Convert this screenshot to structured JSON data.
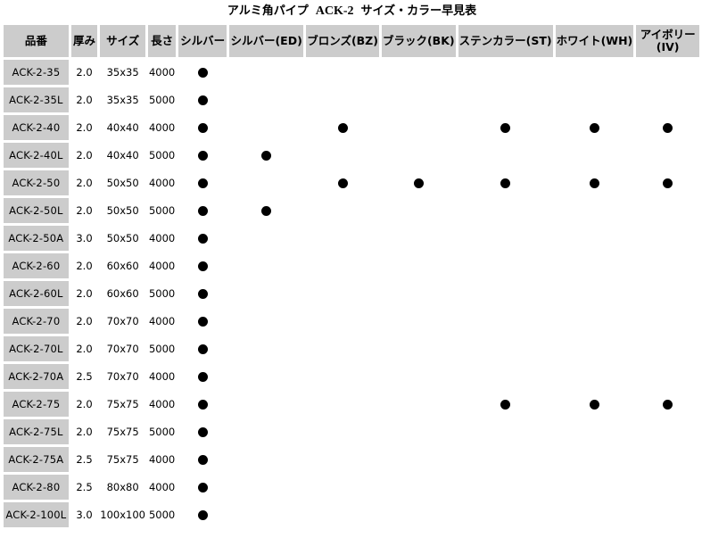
{
  "title": {
    "prefix": "アルミ角パイプ",
    "code": "ACK-2",
    "suffix": "サイズ・カラー早見表"
  },
  "table": {
    "headers": [
      "品番",
      "厚み",
      "サイズ",
      "長さ",
      "シルバー",
      "シルバー(ED)",
      "ブロンズ(BZ)",
      "ブラック(BK)",
      "ステンカラー(ST)",
      "ホワイト(WH)",
      "アイボリー\n(IV)"
    ],
    "header_lines": {
      "ivory_line1": "アイボリー",
      "ivory_line2": "(IV)"
    },
    "availability_marker": "●",
    "rows": [
      {
        "code": "ACK-2-35",
        "thickness": "2.0",
        "size": "35x35",
        "length": "4000",
        "colors": [
          true,
          false,
          false,
          false,
          false,
          false,
          false
        ]
      },
      {
        "code": "ACK-2-35L",
        "thickness": "2.0",
        "size": "35x35",
        "length": "5000",
        "colors": [
          true,
          false,
          false,
          false,
          false,
          false,
          false
        ]
      },
      {
        "code": "ACK-2-40",
        "thickness": "2.0",
        "size": "40x40",
        "length": "4000",
        "colors": [
          true,
          false,
          true,
          false,
          true,
          true,
          true
        ]
      },
      {
        "code": "ACK-2-40L",
        "thickness": "2.0",
        "size": "40x40",
        "length": "5000",
        "colors": [
          true,
          true,
          false,
          false,
          false,
          false,
          false
        ]
      },
      {
        "code": "ACK-2-50",
        "thickness": "2.0",
        "size": "50x50",
        "length": "4000",
        "colors": [
          true,
          false,
          true,
          true,
          true,
          true,
          true
        ]
      },
      {
        "code": "ACK-2-50L",
        "thickness": "2.0",
        "size": "50x50",
        "length": "5000",
        "colors": [
          true,
          true,
          false,
          false,
          false,
          false,
          false
        ]
      },
      {
        "code": "ACK-2-50A",
        "thickness": "3.0",
        "size": "50x50",
        "length": "4000",
        "colors": [
          true,
          false,
          false,
          false,
          false,
          false,
          false
        ]
      },
      {
        "code": "ACK-2-60",
        "thickness": "2.0",
        "size": "60x60",
        "length": "4000",
        "colors": [
          true,
          false,
          false,
          false,
          false,
          false,
          false
        ]
      },
      {
        "code": "ACK-2-60L",
        "thickness": "2.0",
        "size": "60x60",
        "length": "5000",
        "colors": [
          true,
          false,
          false,
          false,
          false,
          false,
          false
        ]
      },
      {
        "code": "ACK-2-70",
        "thickness": "2.0",
        "size": "70x70",
        "length": "4000",
        "colors": [
          true,
          false,
          false,
          false,
          false,
          false,
          false
        ]
      },
      {
        "code": "ACK-2-70L",
        "thickness": "2.0",
        "size": "70x70",
        "length": "5000",
        "colors": [
          true,
          false,
          false,
          false,
          false,
          false,
          false
        ]
      },
      {
        "code": "ACK-2-70A",
        "thickness": "2.5",
        "size": "70x70",
        "length": "4000",
        "colors": [
          true,
          false,
          false,
          false,
          false,
          false,
          false
        ]
      },
      {
        "code": "ACK-2-75",
        "thickness": "2.0",
        "size": "75x75",
        "length": "4000",
        "colors": [
          true,
          false,
          false,
          false,
          true,
          true,
          true
        ]
      },
      {
        "code": "ACK-2-75L",
        "thickness": "2.0",
        "size": "75x75",
        "length": "5000",
        "colors": [
          true,
          false,
          false,
          false,
          false,
          false,
          false
        ]
      },
      {
        "code": "ACK-2-75A",
        "thickness": "2.5",
        "size": "75x75",
        "length": "4000",
        "colors": [
          true,
          false,
          false,
          false,
          false,
          false,
          false
        ]
      },
      {
        "code": "ACK-2-80",
        "thickness": "2.5",
        "size": "80x80",
        "length": "4000",
        "colors": [
          true,
          false,
          false,
          false,
          false,
          false,
          false
        ]
      },
      {
        "code": "ACK-2-100L",
        "thickness": "3.0",
        "size": "100x100",
        "length": "5000",
        "colors": [
          true,
          false,
          false,
          false,
          false,
          false,
          false
        ]
      }
    ]
  },
  "colors": {
    "header_bg": "#cccccc",
    "code_cell_bg": "#cccccc",
    "dot": "#000000"
  }
}
